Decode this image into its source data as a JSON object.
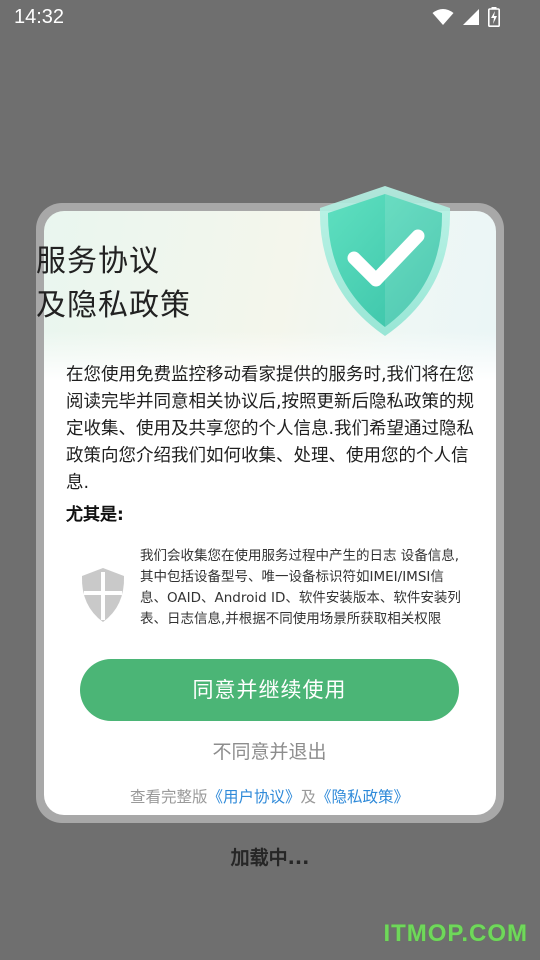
{
  "status_bar": {
    "time": "14:32",
    "icons": [
      "wifi-icon",
      "signal-icon",
      "battery-charging-icon"
    ]
  },
  "dialog": {
    "title_line1": "服务协议",
    "title_line2": "及隐私政策",
    "intro_text": "在您使用免费监控移动看家提供的服务时,我们将在您阅读完毕并同意相关协议后,按照更新后隐私政策的规定收集、使用及共享您的个人信息.我们希望通过隐私政策向您介绍我们如何收集、处理、使用您的个人信息.",
    "especially_label": "尤其是:",
    "detail_text": "我们会收集您在使用服务过程中产生的日志 设备信息,其中包括设备型号、唯一设备标识符如IMEI/IMSI信息、OAID、Android ID、软件安装版本、软件安装列表、日志信息,并根据不同使用场景所获取相关权限",
    "agree_button": "同意并继续使用",
    "disagree_button": "不同意并退出",
    "footer_prefix": "查看完整版",
    "user_agreement_link": "《用户协议》",
    "footer_and": "及",
    "privacy_policy_link": "《隐私政策》"
  },
  "loading_text": "加载中...",
  "watermark": "ITMOP.COM",
  "colors": {
    "accent_green": "#4bb576",
    "link_blue": "#2f8ad9",
    "overlay_gray": "#6f6f6f",
    "watermark_green": "#6fd85a"
  }
}
